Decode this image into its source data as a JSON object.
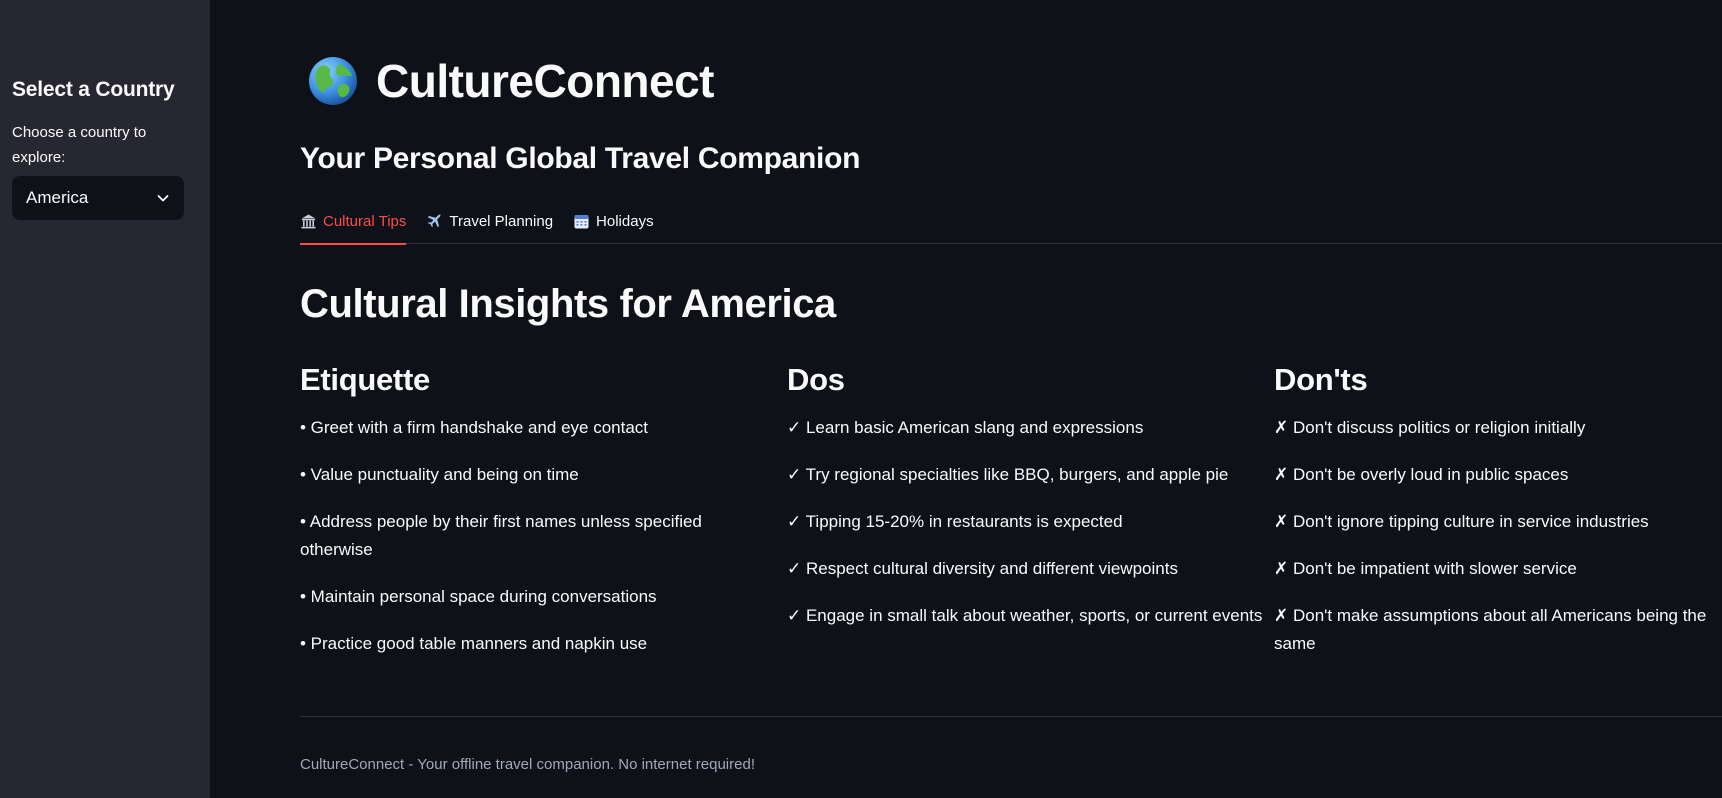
{
  "sidebar": {
    "heading": "Select a Country",
    "select_label": "Choose a country to explore:",
    "selected_country": "America"
  },
  "header": {
    "title": "CultureConnect",
    "subtitle": "Your Personal Global Travel Companion"
  },
  "tabs": [
    {
      "label": "Cultural Tips",
      "icon": "classical-building-icon",
      "active": true
    },
    {
      "label": "Travel Planning",
      "icon": "airplane-icon",
      "active": false
    },
    {
      "label": "Holidays",
      "icon": "calendar-icon",
      "active": false
    }
  ],
  "content": {
    "section_title": "Cultural Insights for America",
    "etiquette": {
      "heading": "Etiquette",
      "items": [
        "• Greet with a firm handshake and eye contact",
        "• Value punctuality and being on time",
        "• Address people by their first names unless specified otherwise",
        "• Maintain personal space during conversations",
        "• Practice good table manners and napkin use"
      ]
    },
    "dos": {
      "heading": "Dos",
      "items": [
        "✓ Learn basic American slang and expressions",
        "✓ Try regional specialties like BBQ, burgers, and apple pie",
        "✓ Tipping 15-20% in restaurants is expected",
        "✓ Respect cultural diversity and different viewpoints",
        "✓ Engage in small talk about weather, sports, or current events"
      ]
    },
    "donts": {
      "heading": "Don'ts",
      "items": [
        "✗ Don't discuss politics or religion initially",
        "✗ Don't be overly loud in public spaces",
        "✗ Don't ignore tipping culture in service industries",
        "✗ Don't be impatient with slower service",
        "✗ Don't make assumptions about all Americans being the same"
      ]
    }
  },
  "footer": {
    "text": "CultureConnect - Your offline travel companion. No internet required!"
  },
  "colors": {
    "background": "#0e1117",
    "sidebar": "#262730",
    "accent": "#ff4b4b",
    "text": "#fafafa",
    "muted": "#a3a8b8"
  }
}
